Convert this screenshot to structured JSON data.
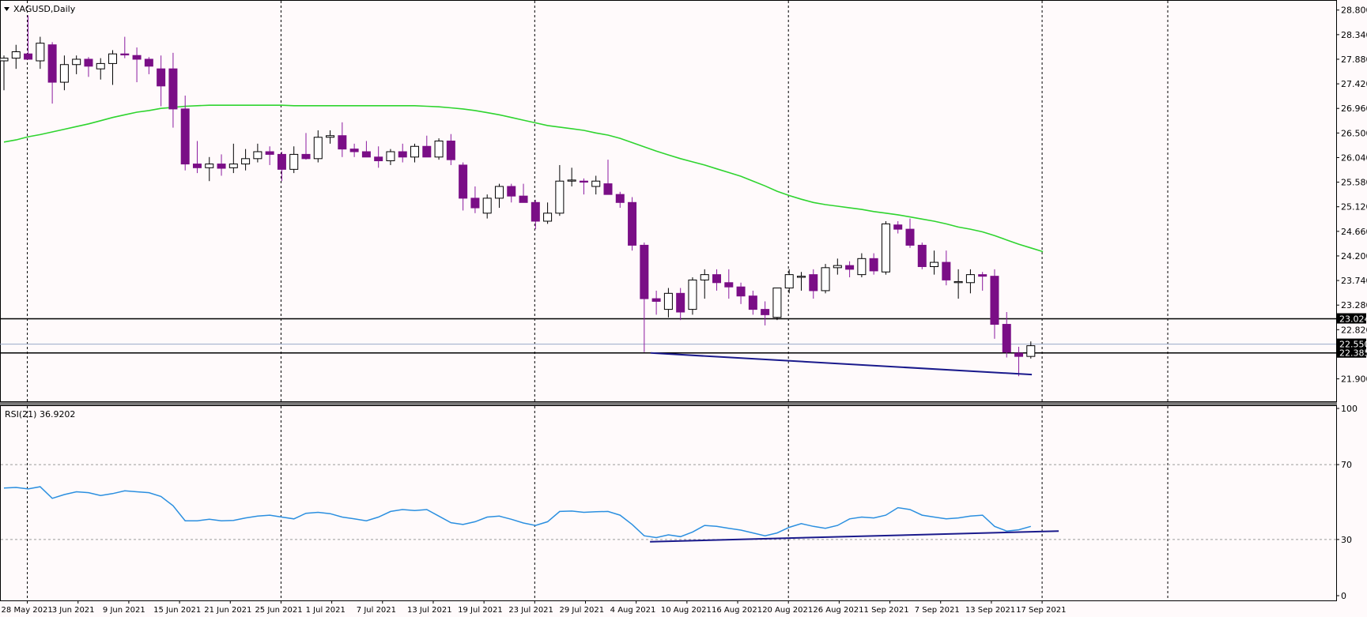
{
  "symbol_title": "XAGUSD,Daily",
  "rsi_title": "RSI(21) 36.9202",
  "colors": {
    "background": "#fffafb",
    "bear_candle": "#7a0e86",
    "bull_candle": "#ffffff",
    "wick": "#8c1ba0",
    "ma_line": "#2fd42f",
    "rsi_line": "#2b8fe0",
    "trend_line": "#1a1a8c",
    "level_line": "#000000",
    "bid_line": "#9aa9c8"
  },
  "chart_data": [
    {
      "type": "candlestick",
      "title": "XAGUSD,Daily",
      "y_ticks": [
        "28.800",
        "28.340",
        "27.880",
        "27.420",
        "26.960",
        "26.500",
        "26.040",
        "25.580",
        "25.120",
        "24.660",
        "24.200",
        "23.740",
        "23.280",
        "22.820",
        "22.360",
        "21.900"
      ],
      "ylim": [
        21.79,
        28.87
      ],
      "x_tick_labels": [
        "28 May 2021",
        "3 Jun 2021",
        "9 Jun 2021",
        "15 Jun 2021",
        "21 Jun 2021",
        "25 Jun 2021",
        "1 Jul 2021",
        "7 Jul 2021",
        "13 Jul 2021",
        "19 Jul 2021",
        "23 Jul 2021",
        "29 Jul 2021",
        "4 Aug 2021",
        "10 Aug 2021",
        "16 Aug 2021",
        "20 Aug 2021",
        "26 Aug 2021",
        "1 Sep 2021",
        "7 Sep 2021",
        "13 Sep 2021",
        "17 Sep 2021"
      ],
      "price_labels": [
        "23.024",
        "22.550",
        "22.385"
      ],
      "horizontal_levels": [
        23.024,
        22.385
      ],
      "bid_level": 22.55,
      "candles": [
        [
          27.85,
          27.95,
          27.3,
          27.9
        ],
        [
          27.9,
          28.15,
          27.7,
          28.02
        ],
        [
          27.98,
          28.7,
          27.9,
          27.88
        ],
        [
          27.85,
          28.3,
          27.7,
          28.18
        ],
        [
          28.15,
          28.2,
          27.05,
          27.45
        ],
        [
          27.45,
          27.95,
          27.3,
          27.78
        ],
        [
          27.78,
          27.95,
          27.6,
          27.88
        ],
        [
          27.88,
          27.92,
          27.55,
          27.75
        ],
        [
          27.7,
          27.9,
          27.5,
          27.8
        ],
        [
          27.8,
          28.05,
          27.4,
          27.98
        ],
        [
          27.98,
          28.3,
          27.9,
          27.96
        ],
        [
          27.95,
          28.1,
          27.45,
          27.88
        ],
        [
          27.88,
          27.92,
          27.6,
          27.75
        ],
        [
          27.7,
          27.95,
          27.0,
          27.38
        ],
        [
          27.7,
          28.0,
          26.6,
          26.95
        ],
        [
          26.95,
          27.2,
          25.8,
          25.92
        ],
        [
          25.92,
          26.35,
          25.75,
          25.85
        ],
        [
          25.85,
          26.05,
          25.6,
          25.92
        ],
        [
          25.92,
          26.1,
          25.7,
          25.84
        ],
        [
          25.85,
          26.3,
          25.75,
          25.92
        ],
        [
          25.92,
          26.2,
          25.8,
          26.02
        ],
        [
          26.02,
          26.3,
          25.95,
          26.15
        ],
        [
          26.15,
          26.25,
          25.9,
          26.1
        ],
        [
          26.1,
          26.15,
          25.6,
          25.82
        ],
        [
          25.82,
          26.25,
          25.75,
          26.1
        ],
        [
          26.1,
          26.5,
          26.0,
          26.02
        ],
        [
          26.02,
          26.55,
          25.95,
          26.42
        ],
        [
          26.42,
          26.55,
          26.3,
          26.45
        ],
        [
          26.45,
          26.7,
          26.05,
          26.2
        ],
        [
          26.2,
          26.3,
          26.05,
          26.15
        ],
        [
          26.15,
          26.35,
          26.05,
          26.05
        ],
        [
          26.05,
          26.25,
          25.85,
          25.98
        ],
        [
          25.98,
          26.2,
          25.9,
          26.15
        ],
        [
          26.15,
          26.3,
          25.95,
          26.05
        ],
        [
          26.05,
          26.3,
          25.95,
          26.25
        ],
        [
          26.25,
          26.45,
          26.05,
          26.05
        ],
        [
          26.05,
          26.4,
          26.0,
          26.35
        ],
        [
          26.35,
          26.48,
          25.9,
          26.0
        ],
        [
          25.9,
          25.95,
          25.05,
          25.28
        ],
        [
          25.28,
          25.5,
          25.0,
          25.1
        ],
        [
          25.0,
          25.35,
          24.9,
          25.28
        ],
        [
          25.28,
          25.55,
          25.1,
          25.5
        ],
        [
          25.5,
          25.55,
          25.2,
          25.32
        ],
        [
          25.32,
          25.55,
          25.2,
          25.2
        ],
        [
          25.2,
          25.25,
          24.7,
          24.85
        ],
        [
          24.85,
          25.2,
          24.8,
          25.0
        ],
        [
          25.0,
          25.9,
          24.95,
          25.6
        ],
        [
          25.6,
          25.85,
          25.5,
          25.62
        ],
        [
          25.6,
          25.65,
          25.35,
          25.58
        ],
        [
          25.5,
          25.7,
          25.35,
          25.6
        ],
        [
          25.55,
          26.0,
          25.45,
          25.35
        ],
        [
          25.35,
          25.4,
          25.1,
          25.2
        ],
        [
          25.2,
          25.3,
          24.3,
          24.4
        ],
        [
          24.4,
          24.45,
          22.4,
          23.4
        ],
        [
          23.4,
          23.55,
          23.1,
          23.35
        ],
        [
          23.2,
          23.6,
          23.05,
          23.5
        ],
        [
          23.5,
          23.6,
          23.0,
          23.15
        ],
        [
          23.2,
          23.8,
          23.1,
          23.75
        ],
        [
          23.75,
          23.95,
          23.4,
          23.85
        ],
        [
          23.85,
          23.95,
          23.55,
          23.7
        ],
        [
          23.7,
          23.95,
          23.4,
          23.62
        ],
        [
          23.62,
          23.7,
          23.3,
          23.45
        ],
        [
          23.45,
          23.55,
          23.1,
          23.2
        ],
        [
          23.2,
          23.35,
          22.9,
          23.1
        ],
        [
          23.05,
          23.6,
          23.0,
          23.6
        ],
        [
          23.6,
          23.95,
          23.5,
          23.85
        ],
        [
          23.8,
          23.9,
          23.55,
          23.82
        ],
        [
          23.85,
          23.95,
          23.4,
          23.55
        ],
        [
          23.55,
          24.05,
          23.5,
          23.98
        ],
        [
          23.98,
          24.15,
          23.85,
          24.02
        ],
        [
          24.02,
          24.1,
          23.8,
          23.95
        ],
        [
          23.85,
          24.25,
          23.8,
          24.15
        ],
        [
          24.15,
          24.25,
          23.85,
          23.92
        ],
        [
          23.9,
          24.85,
          23.85,
          24.8
        ],
        [
          24.78,
          24.85,
          24.62,
          24.7
        ],
        [
          24.7,
          24.9,
          24.35,
          24.4
        ],
        [
          24.4,
          24.45,
          23.95,
          24.0
        ],
        [
          24.0,
          24.3,
          23.85,
          24.08
        ],
        [
          24.08,
          24.3,
          23.65,
          23.75
        ],
        [
          23.7,
          23.95,
          23.4,
          23.72
        ],
        [
          23.7,
          23.95,
          23.5,
          23.85
        ],
        [
          23.85,
          23.9,
          23.55,
          23.82
        ],
        [
          23.82,
          23.95,
          22.65,
          22.92
        ],
        [
          22.92,
          23.15,
          22.3,
          22.4
        ],
        [
          22.38,
          22.5,
          21.95,
          22.32
        ],
        [
          22.32,
          22.6,
          22.28,
          22.52
        ]
      ],
      "ma_values": [
        26.33,
        26.37,
        26.43,
        26.47,
        26.52,
        26.57,
        26.62,
        26.67,
        26.73,
        26.79,
        26.84,
        26.89,
        26.92,
        26.96,
        26.98,
        27.0,
        27.01,
        27.02,
        27.02,
        27.02,
        27.02,
        27.02,
        27.02,
        27.02,
        27.01,
        27.01,
        27.01,
        27.01,
        27.01,
        27.01,
        27.01,
        27.01,
        27.01,
        27.01,
        27.01,
        27.0,
        26.99,
        26.97,
        26.95,
        26.92,
        26.88,
        26.84,
        26.79,
        26.74,
        26.69,
        26.64,
        26.61,
        26.58,
        26.55,
        26.5,
        26.46,
        26.4,
        26.32,
        26.24,
        26.16,
        26.09,
        26.02,
        25.96,
        25.9,
        25.83,
        25.76,
        25.69,
        25.6,
        25.51,
        25.41,
        25.33,
        25.26,
        25.2,
        25.16,
        25.13,
        25.1,
        25.07,
        25.03,
        25.0,
        24.97,
        24.93,
        24.89,
        24.85,
        24.8,
        24.74,
        24.7,
        24.65,
        24.58,
        24.5,
        24.42,
        24.35,
        24.28
      ],
      "support_trendline": [
        [
          53,
          22.385
        ],
        [
          86,
          21.98
        ]
      ]
    },
    {
      "type": "line",
      "title": "RSI(21) 36.9202",
      "y_ticks": [
        "100",
        "70",
        "30",
        "0"
      ],
      "ylim": [
        0,
        100
      ],
      "levels": [
        70,
        30
      ],
      "rsi_values": [
        57.5,
        57.8,
        57.0,
        58.2,
        52.0,
        54.0,
        55.5,
        55.0,
        53.5,
        54.5,
        56.0,
        55.5,
        55.0,
        53.0,
        48.0,
        40.0,
        40.0,
        40.8,
        40.0,
        40.2,
        41.5,
        42.5,
        43.0,
        42.0,
        41.0,
        44.0,
        44.5,
        43.8,
        42.0,
        41.0,
        40.0,
        42.0,
        45.0,
        46.0,
        45.5,
        46.0,
        42.5,
        39.0,
        38.0,
        39.5,
        42.0,
        42.5,
        40.8,
        38.8,
        37.5,
        39.5,
        45.0,
        45.2,
        44.5,
        44.8,
        45.0,
        43.0,
        38.0,
        32.0,
        31.0,
        32.5,
        31.5,
        34.0,
        37.5,
        37.0,
        36.0,
        35.0,
        33.5,
        32.0,
        33.5,
        36.5,
        38.5,
        37.0,
        36.0,
        37.5,
        41.0,
        42.0,
        41.5,
        43.0,
        47.0,
        46.0,
        43.0,
        42.0,
        41.0,
        41.5,
        42.5,
        43.0,
        37.0,
        34.5,
        35.2,
        37.0
      ],
      "trendline": [
        [
          54,
          28.8
        ],
        [
          86,
          34.5
        ]
      ]
    }
  ]
}
